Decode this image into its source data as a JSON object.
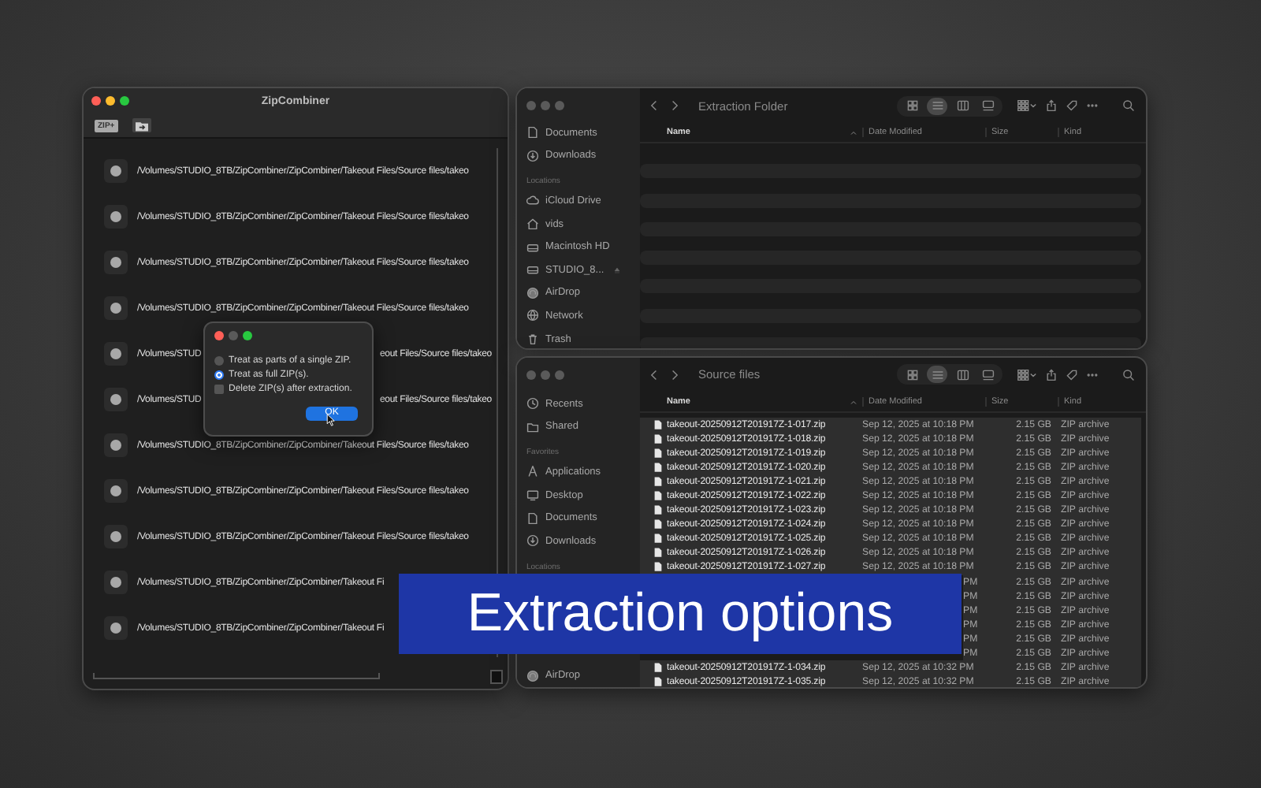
{
  "zip_window": {
    "title": "ZipCombiner",
    "active": true,
    "toolbar": {
      "zip_button": "ZIP+"
    },
    "files": [
      {
        "kind": "full",
        "path": "/Volumes/STUDIO_8TB/ZipCombiner/ZipCombiner/Takeout Files/Source files/takeo"
      },
      {
        "kind": "full",
        "path": "/Volumes/STUDIO_8TB/ZipCombiner/ZipCombiner/Takeout Files/Source files/takeo"
      },
      {
        "kind": "full",
        "path": "/Volumes/STUDIO_8TB/ZipCombiner/ZipCombiner/Takeout Files/Source files/takeo"
      },
      {
        "kind": "full",
        "path": "/Volumes/STUDIO_8TB/ZipCombiner/ZipCombiner/Takeout Files/Source files/takeo"
      },
      {
        "kind": "split",
        "path_start": "/Volumes/STUD",
        "path_end": "eout Files/Source files/takeo"
      },
      {
        "kind": "split",
        "path_start": "/Volumes/STUD",
        "path_end": "eout Files/Source files/takeo"
      },
      {
        "kind": "full",
        "path": "/Volumes/STUDIO_8TB/ZipCombiner/ZipCombiner/Takeout Files/Source files/takeo"
      },
      {
        "kind": "full",
        "path": "/Volumes/STUDIO_8TB/ZipCombiner/ZipCombiner/Takeout Files/Source files/takeo"
      },
      {
        "kind": "full",
        "path": "/Volumes/STUDIO_8TB/ZipCombiner/ZipCombiner/Takeout Files/Source files/takeo"
      },
      {
        "kind": "full",
        "path": "/Volumes/STUDIO_8TB/ZipCombiner/ZipCombiner/Takeout Fi"
      },
      {
        "kind": "full",
        "path": "/Volumes/STUDIO_8TB/ZipCombiner/ZipCombiner/Takeout Fi"
      }
    ]
  },
  "options_dialog": {
    "active": true,
    "minimize_enabled": false,
    "options": [
      {
        "kind": "radio",
        "label": "Treat as parts of a single ZIP.",
        "selected": false
      },
      {
        "kind": "radio",
        "label": "Treat as full ZIP(s).",
        "selected": true
      },
      {
        "kind": "checkbox",
        "label": "Delete ZIP(s) after extraction.",
        "checked": false
      }
    ],
    "ok_button": "OK"
  },
  "extraction_window": {
    "title": "Extraction Folder",
    "active": false,
    "sidebar": [
      {
        "kind": "item",
        "label": "Documents"
      },
      {
        "kind": "item",
        "label": "Downloads"
      },
      {
        "kind": "header",
        "label": "Locations"
      },
      {
        "kind": "item",
        "label": "iCloud Drive"
      },
      {
        "kind": "item",
        "label": "vids"
      },
      {
        "kind": "item",
        "label": "Macintosh HD"
      },
      {
        "kind": "item",
        "label": "STUDIO_8...",
        "ejectable": true
      },
      {
        "kind": "item",
        "label": "AirDrop"
      },
      {
        "kind": "item",
        "label": "Network"
      },
      {
        "kind": "item",
        "label": "Trash"
      }
    ],
    "view_modes": [
      {
        "selected": false
      },
      {
        "selected": true
      },
      {
        "selected": false
      },
      {
        "selected": false
      }
    ],
    "columns": [
      {
        "label": "Name",
        "sorted": true
      },
      {
        "label": "Date Modified",
        "sorted": false
      },
      {
        "label": "Size",
        "sorted": false
      },
      {
        "label": "Kind",
        "sorted": false
      }
    ]
  },
  "source_window": {
    "title": "Source files",
    "active": false,
    "sidebar": [
      {
        "kind": "item",
        "label": "Recents"
      },
      {
        "kind": "item",
        "label": "Shared"
      },
      {
        "kind": "header",
        "label": "Favorites"
      },
      {
        "kind": "item",
        "label": "Applications"
      },
      {
        "kind": "item",
        "label": "Desktop"
      },
      {
        "kind": "item",
        "label": "Documents"
      },
      {
        "kind": "item",
        "label": "Downloads"
      },
      {
        "kind": "header",
        "label": "Locations"
      },
      {
        "kind": "item",
        "label": "AirDrop"
      }
    ],
    "view_modes": [
      {
        "selected": false
      },
      {
        "selected": true
      },
      {
        "selected": false
      },
      {
        "selected": false
      }
    ],
    "columns": [
      {
        "label": "Name",
        "sorted": true
      },
      {
        "label": "Date Modified",
        "sorted": false
      },
      {
        "label": "Size",
        "sorted": false
      },
      {
        "label": "Kind",
        "sorted": false
      }
    ],
    "files": [
      {
        "kind": "row",
        "name": "takeout-20250912T201917Z-1-017.zip",
        "date": "Sep 12, 2025 at 10:18 PM",
        "size": "2.15 GB",
        "type": "ZIP archive",
        "selected": true
      },
      {
        "kind": "row",
        "name": "takeout-20250912T201917Z-1-018.zip",
        "date": "Sep 12, 2025 at 10:18 PM",
        "size": "2.15 GB",
        "type": "ZIP archive",
        "selected": true
      },
      {
        "kind": "row",
        "name": "takeout-20250912T201917Z-1-019.zip",
        "date": "Sep 12, 2025 at 10:18 PM",
        "size": "2.15 GB",
        "type": "ZIP archive",
        "selected": true
      },
      {
        "kind": "row",
        "name": "takeout-20250912T201917Z-1-020.zip",
        "date": "Sep 12, 2025 at 10:18 PM",
        "size": "2.15 GB",
        "type": "ZIP archive",
        "selected": true
      },
      {
        "kind": "row",
        "name": "takeout-20250912T201917Z-1-021.zip",
        "date": "Sep 12, 2025 at 10:18 PM",
        "size": "2.15 GB",
        "type": "ZIP archive",
        "selected": true
      },
      {
        "kind": "row",
        "name": "takeout-20250912T201917Z-1-022.zip",
        "date": "Sep 12, 2025 at 10:18 PM",
        "size": "2.15 GB",
        "type": "ZIP archive",
        "selected": true
      },
      {
        "kind": "row",
        "name": "takeout-20250912T201917Z-1-023.zip",
        "date": "Sep 12, 2025 at 10:18 PM",
        "size": "2.15 GB",
        "type": "ZIP archive",
        "selected": true
      },
      {
        "kind": "row",
        "name": "takeout-20250912T201917Z-1-024.zip",
        "date": "Sep 12, 2025 at 10:18 PM",
        "size": "2.15 GB",
        "type": "ZIP archive",
        "selected": true
      },
      {
        "kind": "row",
        "name": "takeout-20250912T201917Z-1-025.zip",
        "date": "Sep 12, 2025 at 10:18 PM",
        "size": "2.15 GB",
        "type": "ZIP archive",
        "selected": true
      },
      {
        "kind": "row",
        "name": "takeout-20250912T201917Z-1-026.zip",
        "date": "Sep 12, 2025 at 10:18 PM",
        "size": "2.15 GB",
        "type": "ZIP archive",
        "selected": true
      },
      {
        "kind": "row",
        "name": "takeout-20250912T201917Z-1-027.zip",
        "date": "Sep 12, 2025 at 10:18 PM",
        "size": "2.15 GB",
        "type": "ZIP archive",
        "selected": true
      },
      {
        "kind": "covered",
        "date": "PM",
        "size": "2.15 GB",
        "type": "ZIP archive",
        "selected": true
      },
      {
        "kind": "covered",
        "date": "PM",
        "size": "2.15 GB",
        "type": "ZIP archive",
        "selected": true
      },
      {
        "kind": "covered",
        "date": "PM",
        "size": "2.15 GB",
        "type": "ZIP archive",
        "selected": true
      },
      {
        "kind": "covered",
        "date": "PM",
        "size": "2.15 GB",
        "type": "ZIP archive",
        "selected": true
      },
      {
        "kind": "covered",
        "date": "PM",
        "size": "2.15 GB",
        "type": "ZIP archive",
        "selected": true
      },
      {
        "kind": "covered",
        "date": "PM",
        "size": "2.15 GB",
        "type": "ZIP archive",
        "selected": true
      },
      {
        "kind": "row",
        "name": "takeout-20250912T201917Z-1-034.zip",
        "date": "Sep 12, 2025 at 10:32 PM",
        "size": "2.15 GB",
        "type": "ZIP archive",
        "selected": true
      },
      {
        "kind": "row",
        "name": "takeout-20250912T201917Z-1-035.zip",
        "date": "Sep 12, 2025 at 10:32 PM",
        "size": "2.15 GB",
        "type": "ZIP archive",
        "selected": true
      }
    ]
  },
  "caption": "Extraction options"
}
